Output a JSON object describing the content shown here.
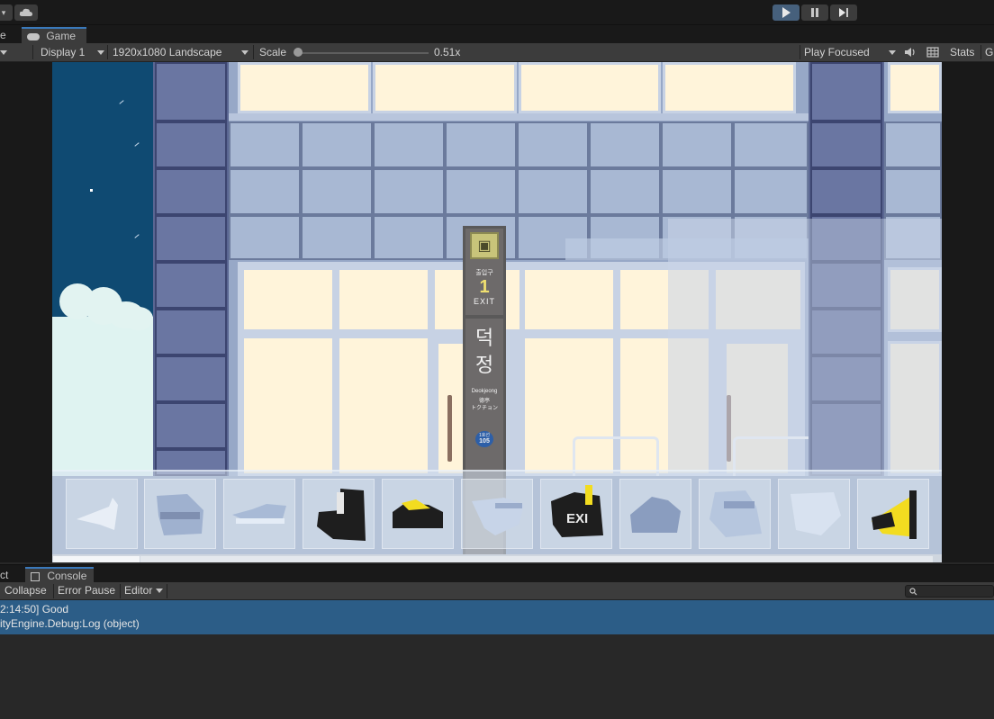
{
  "toolbar": {
    "cloud_icon": "cloud-icon",
    "play_icon": "play-icon",
    "pause_icon": "pause-icon",
    "step_icon": "step-icon"
  },
  "tabs": {
    "prev_tab_label": "e",
    "game_tab_label": "Game",
    "game_tab_icon": "gamepad-icon"
  },
  "gamebar": {
    "display": "Display 1",
    "resolution": "1920x1080 Landscape",
    "scale_label": "Scale",
    "scale_value": "0.51x",
    "scale_fraction": 0.02,
    "play_mode": "Play Focused",
    "audio_icon": "speaker-icon",
    "gizmo_grid_icon": "grid-icon",
    "stats": "Stats",
    "gizmos_partial": "G"
  },
  "game": {
    "sign": {
      "exit_label_ko": "출입구",
      "exit_number": "1",
      "exit_en": "EXIT",
      "station_ko_1": "덕",
      "station_ko_2": "정",
      "station_en": "Deokjeong",
      "station_hanja": "德亭",
      "station_jp": "トクチョン",
      "line_no": "1호선",
      "station_code": "105"
    },
    "inventory_piece_text": "EXI",
    "inventory_scroll_fraction": 0.1
  },
  "console": {
    "prev_tab_label": "ct",
    "console_tab_label": "Console",
    "console_tab_icon": "console-icon",
    "collapse": "Collapse",
    "error_pause": "Error Pause",
    "editor": "Editor",
    "search_icon": "search-icon",
    "search_placeholder": "",
    "log_line_1": "2:14:50] Good",
    "log_line_2": "ityEngine.Debug:Log (object)"
  }
}
